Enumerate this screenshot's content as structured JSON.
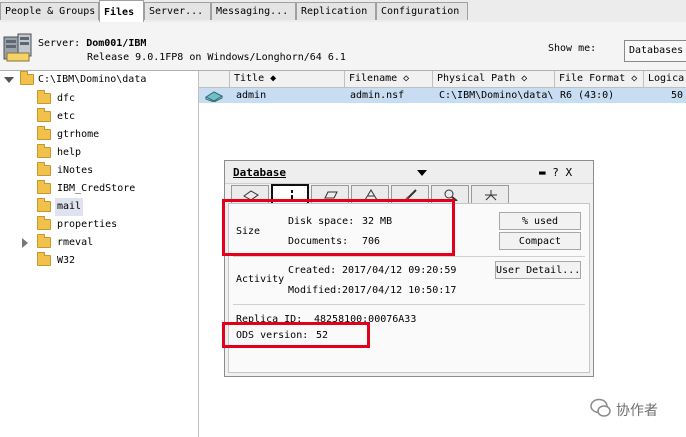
{
  "tabs": [
    {
      "label": "People & Groups"
    },
    {
      "label": "Files"
    },
    {
      "label": "Server..."
    },
    {
      "label": "Messaging..."
    },
    {
      "label": "Replication"
    },
    {
      "label": "Configuration"
    }
  ],
  "header": {
    "server_prefix": "Server:",
    "server_name": "Dom001/IBM",
    "release": "Release 9.0.1FP8 on Windows/Longhorn/64 6.1",
    "show_me_label": "Show me:",
    "show_me_value": "Databases"
  },
  "tree": {
    "root": "C:\\IBM\\Domino\\data",
    "items": [
      {
        "label": "dfc"
      },
      {
        "label": "etc"
      },
      {
        "label": "gtrhome"
      },
      {
        "label": "help"
      },
      {
        "label": "iNotes"
      },
      {
        "label": "IBM_CredStore"
      },
      {
        "label": "mail"
      },
      {
        "label": "properties"
      },
      {
        "label": "rmeval"
      },
      {
        "label": "W32"
      }
    ],
    "selected": "mail"
  },
  "list": {
    "columns": [
      {
        "label": "Title ◆"
      },
      {
        "label": "Filename ◇"
      },
      {
        "label": "Physical Path ◇"
      },
      {
        "label": "File Format ◇"
      },
      {
        "label": "Logica"
      }
    ],
    "rows": [
      {
        "title": "admin",
        "filename": "admin.nsf",
        "path": "C:\\IBM\\Domino\\data\\",
        "format": "R6 (43:0)",
        "logical": "50"
      }
    ]
  },
  "database_box": {
    "type_label": "Database",
    "controls": "▬ ? X",
    "size_label": "Size",
    "disk_space_label": "Disk space:",
    "disk_space_value": "32 MB",
    "documents_label": "Documents:",
    "documents_value": "706",
    "pct_used_button": "% used",
    "compact_button": "Compact",
    "activity_label": "Activity",
    "created_label": "Created:",
    "created_value": "2017/04/12 09:20:59",
    "modified_label": "Modified:",
    "modified_value": "2017/04/12 10:50:17",
    "user_detail_button": "User Detail...",
    "replica_label": "Replica ID:",
    "replica_value": "48258100:00076A33",
    "ods_label": "ODS version:",
    "ods_value": "52"
  },
  "watermark": {
    "text": "协作者"
  },
  "colors": {
    "highlight": "#e3001b",
    "selected_row": "#c9ddf2",
    "folder": "#f0c14b"
  }
}
